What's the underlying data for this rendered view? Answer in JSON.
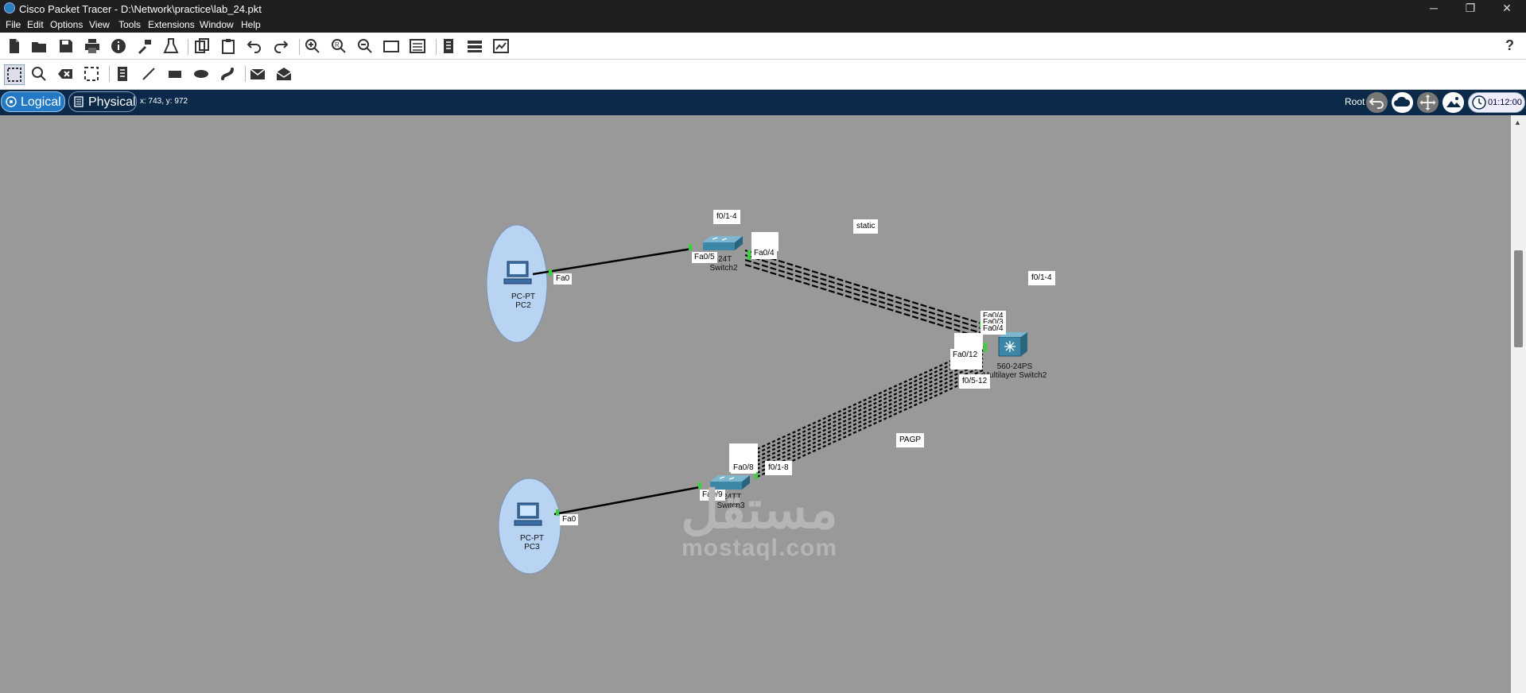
{
  "window": {
    "title": "Cisco Packet Tracer - D:\\Network\\practice\\lab_24.pkt",
    "minimize": "─",
    "restore": "❐",
    "close": "✕"
  },
  "menu": [
    "File",
    "Edit",
    "Options",
    "View",
    "Tools",
    "Extensions",
    "Window",
    "Help"
  ],
  "toolbar_main": [
    "new-icon",
    "open-icon",
    "save-icon",
    "print-icon",
    "info-icon",
    "activity-wizard-icon",
    "custom-device-icon",
    "copy-icon",
    "paste-icon",
    "undo-icon",
    "redo-icon",
    "zoom-in-icon",
    "zoom-reset-icon",
    "zoom-out-icon",
    "drawing-palette-icon",
    "custom-devices-dialog-icon",
    "viewport-icon",
    "cluster-icon",
    "screenshot-icon",
    "help-icon"
  ],
  "help_label": "?",
  "toolbar_edit": [
    "select-icon",
    "inspect-icon",
    "delete-icon",
    "resize-icon",
    "note-icon",
    "line-icon",
    "rectangle-icon",
    "ellipse-icon",
    "freeform-icon",
    "simple-pdu-icon",
    "complex-pdu-icon"
  ],
  "nav": {
    "logical_label": "Logical",
    "physical_label": "Physical",
    "coords": "x: 743, y: 972",
    "root_label": "Root",
    "time": "01:12:00"
  },
  "accent": {
    "logical_tab": "#2479c4",
    "navbar": "#0b2a4a",
    "canvas": "#999999",
    "link_green": "#3ad23a"
  },
  "devices": {
    "pc2": {
      "model": "PC-PT",
      "name": "PC2"
    },
    "pc3": {
      "model": "PC-PT",
      "name": "PC3"
    },
    "switch2": {
      "model": "2960-24TT",
      "model_visible": "-24T",
      "name": "Switch2"
    },
    "switch3": {
      "model": "2960-24TT",
      "model_visible": "-24TT",
      "name": "Switch3"
    },
    "mls2": {
      "model": "3560-24PS",
      "model_visible": "560-24PS",
      "name": "Multilayer Switch2"
    }
  },
  "ports": {
    "pc2_fa0": "Fa0",
    "pc3_fa0": "Fa0",
    "sw2_fa05": "Fa0/5",
    "sw2_fa04": "Fa0/4",
    "sw2_fa04_stack": "Fa0/3",
    "sw3_fa09": "Fa0/9",
    "sw3_fa08": "Fa0/8",
    "mls_fa04a": "Fa0/4",
    "mls_fa03": "Fa0/3",
    "mls_fa04b": "Fa0/4",
    "mls_fa012": "Fa0/12"
  },
  "notes": {
    "sw2_range": "f0/1-4",
    "static": "static",
    "mls_range_top": "f0/1-4",
    "mls_range_bottom": "f0/5-12",
    "pagp": "PAGP",
    "sw3_range": "f0/1-8"
  },
  "watermark": {
    "arabic": "مستقل",
    "latin": "mostaql.com"
  }
}
